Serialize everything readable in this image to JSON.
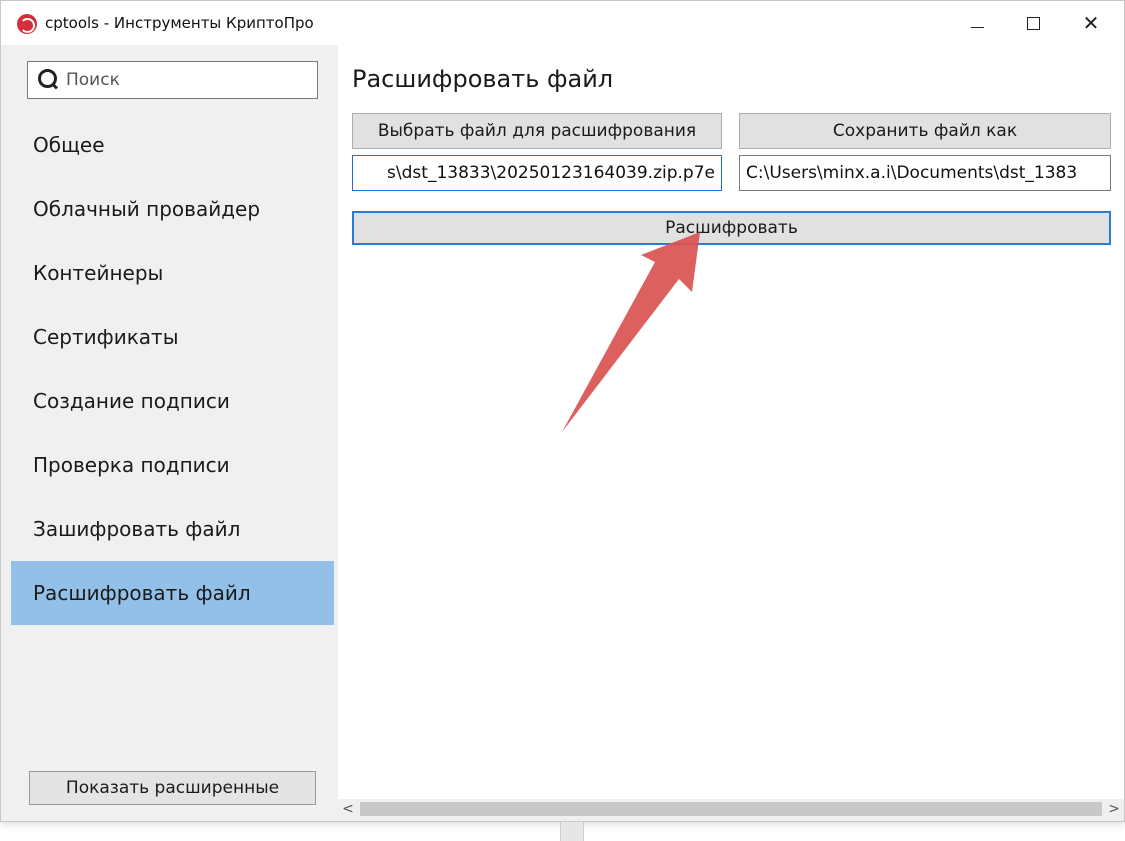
{
  "window": {
    "title": "cptools - Инструменты КриптоПро",
    "minimize": "—",
    "close": "✕"
  },
  "sidebar": {
    "search_placeholder": "Поиск",
    "items": [
      {
        "label": "Общее"
      },
      {
        "label": "Облачный провайдер"
      },
      {
        "label": "Контейнеры"
      },
      {
        "label": "Сертификаты"
      },
      {
        "label": "Создание подписи"
      },
      {
        "label": "Проверка подписи"
      },
      {
        "label": "Зашифровать файл"
      },
      {
        "label": "Расшифровать файл",
        "active": true
      }
    ],
    "advanced_label": "Показать расширенные"
  },
  "main": {
    "title": "Расшифровать файл",
    "select_file_label": "Выбрать файл для расшифрования",
    "save_as_label": "Сохранить файл как",
    "input_path": "s\\dst_13833\\20250123164039.zip.p7e",
    "output_path": "C:\\Users\\minx.a.i\\Documents\\dst_1383",
    "decrypt_label": "Расшифровать"
  },
  "scrollbar": {
    "left_glyph": "<",
    "right_glyph": ">"
  },
  "colors": {
    "active_item": "#93c0e8",
    "focus_border": "#2a7bd4",
    "annotation_arrow": "#d9534f"
  }
}
